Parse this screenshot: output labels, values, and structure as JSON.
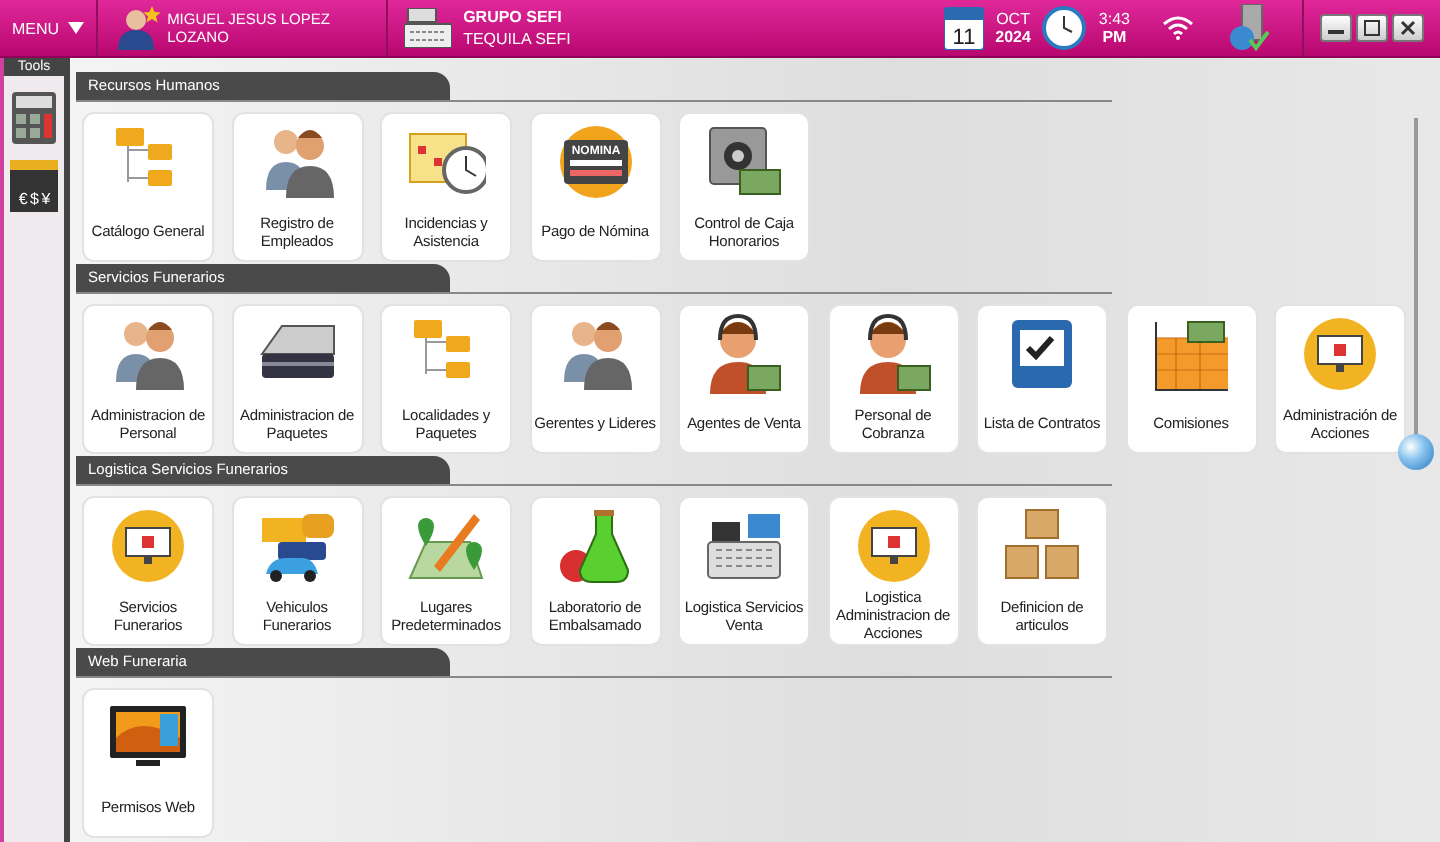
{
  "top_bar": {
    "menu": "MENU",
    "user": {
      "first_line": "MIGUEL JESUS LOPEZ",
      "second_line": "LOZANO"
    },
    "company": {
      "name": "GRUPO SEFI",
      "branch": "TEQUILA SEFI"
    },
    "date": {
      "day": "11",
      "month": "OCT",
      "year": "2024"
    },
    "time": {
      "clock": "3:43",
      "period": "PM"
    }
  },
  "tools": {
    "title": "Tools",
    "exchange_symbols": "€ $ ¥"
  },
  "sections": [
    {
      "title": "Recursos Humanos",
      "tiles": [
        {
          "label": "Catálogo General"
        },
        {
          "label": "Registro de Empleados"
        },
        {
          "label": "Incidencias y Asistencia"
        },
        {
          "label": "Pago de Nómina",
          "icon_text": "NOMINA"
        },
        {
          "label": "Control de Caja Honorarios"
        }
      ]
    },
    {
      "title": "Servicios Funerarios",
      "tiles": [
        {
          "label": "Administracion de Personal"
        },
        {
          "label": "Administracion de Paquetes"
        },
        {
          "label": "Localidades y Paquetes"
        },
        {
          "label": "Gerentes y Lideres"
        },
        {
          "label": "Agentes de Venta"
        },
        {
          "label": "Personal de Cobranza"
        },
        {
          "label": "Lista de Contratos"
        },
        {
          "label": "Comisiones"
        },
        {
          "label": "Administración de Acciones"
        }
      ]
    },
    {
      "title": "Logistica Servicios Funerarios",
      "tiles": [
        {
          "label": "Servicios Funerarios"
        },
        {
          "label": "Vehiculos Funerarios"
        },
        {
          "label": "Lugares Predeterminados"
        },
        {
          "label": "Laboratorio de Embalsamado"
        },
        {
          "label": "Logistica Servicios Venta"
        },
        {
          "label": "Logistica Administracion de Acciones"
        },
        {
          "label": "Definicion de articulos"
        }
      ]
    },
    {
      "title": "Web Funeraria",
      "tiles": [
        {
          "label": "Permisos Web"
        }
      ]
    }
  ]
}
